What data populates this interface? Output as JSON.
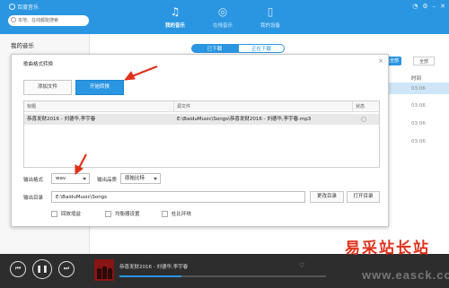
{
  "app": {
    "title": "百度音乐"
  },
  "search": {
    "placeholder": "本地、在线都能搜索"
  },
  "nav": {
    "tabs": [
      {
        "label": "我的音乐",
        "icon": "music-note-icon"
      },
      {
        "label": "在线音乐",
        "icon": "globe-icon"
      },
      {
        "label": "我的设备",
        "icon": "phone-icon"
      }
    ]
  },
  "window_controls": [
    "skin-icon",
    "settings-icon",
    "minimize-icon",
    "close-icon"
  ],
  "sidebar": {
    "title": "我的音乐"
  },
  "background": {
    "segments": [
      "已下载",
      "正在下载"
    ],
    "select_all": "选全部",
    "second_button": "全部",
    "col_time": "时间",
    "times": [
      "03:06",
      "03:06",
      "03:06",
      "03:06"
    ]
  },
  "dialog": {
    "title": "歌曲格式转换",
    "add_file": "添加文件",
    "start_convert": "开始转换",
    "table": {
      "headers": [
        "标题",
        "源文件",
        "状态"
      ],
      "rows": [
        {
          "title": "恭喜发财2016 - 刘德华,李宇春",
          "source": "E:\\BaiduMusic\\Songs\\恭喜发财2016 - 刘德华,李宇春.mp3"
        }
      ]
    },
    "output_format_label": "输出格式",
    "output_format_value": "wav",
    "output_quality_label": "输出品质",
    "output_quality_value": "原始比特",
    "output_dir_label": "输出目录",
    "output_dir_value": "E:\\BaiduMusic\\Songs",
    "change_dir": "更改目录",
    "open_dir": "打开目录",
    "checks": [
      "回放增益",
      "均衡器设置",
      "杜比环绕"
    ]
  },
  "player": {
    "now_playing": "恭喜发财2016 - 刘德华,李宇春",
    "progress": 0.3
  },
  "watermark": {
    "main": "易采站长站",
    "url": "www.easck.com"
  },
  "colors": {
    "accent": "#2a96e2",
    "annotation": "#e0311b"
  }
}
